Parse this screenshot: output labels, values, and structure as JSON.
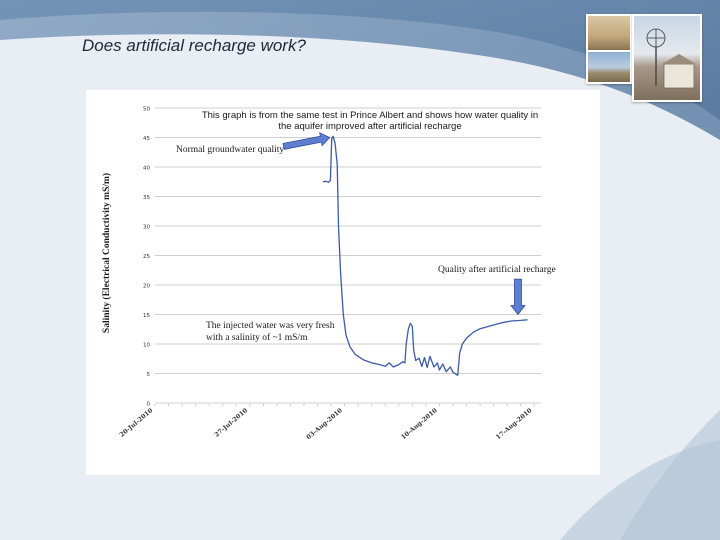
{
  "slide": {
    "title": "Does artificial recharge work?"
  },
  "annotations": {
    "top_line1": "This graph is from the same test in Prince Albert and shows how water quality in",
    "top_line2": "the aquifer improved after artificial recharge",
    "normal": "Normal groundwater quality",
    "after": "Quality after artificial recharge",
    "injected_line1": "The injected water was very fresh",
    "injected_line2": "with a salinity of ~1 mS/m"
  },
  "colors": {
    "series": "#3b5ba5",
    "grid": "#bfbfbf",
    "arrow_fill": "#5e7fd0",
    "arrow_stroke": "#2f4f9e"
  },
  "chart_data": {
    "type": "line",
    "title": "",
    "xlabel": "",
    "ylabel": "Salinity (Electrical Conductivity mS/m)",
    "ylim": [
      0,
      50
    ],
    "yticks": [
      "0",
      "5",
      "10",
      "15",
      "20",
      "25",
      "30",
      "35",
      "40",
      "45",
      "50"
    ],
    "xlim": [
      0,
      28.5
    ],
    "xticks": [
      {
        "x": 0,
        "label": "20-Jul-2010"
      },
      {
        "x": 7,
        "label": "27-Jul-2010"
      },
      {
        "x": 14,
        "label": "03-Aug-2010"
      },
      {
        "x": 21,
        "label": "10-Aug-2010"
      },
      {
        "x": 28,
        "label": "17-Aug-2010"
      }
    ],
    "grid": true,
    "series": [
      {
        "name": "",
        "points": [
          [
            12.4,
            37.5
          ],
          [
            12.6,
            37.6
          ],
          [
            12.8,
            37.4
          ],
          [
            12.95,
            37.7
          ],
          [
            13.05,
            44.8
          ],
          [
            13.15,
            45.2
          ],
          [
            13.3,
            44.0
          ],
          [
            13.45,
            40.5
          ],
          [
            13.55,
            30.0
          ],
          [
            13.7,
            22.0
          ],
          [
            13.9,
            15.0
          ],
          [
            14.1,
            11.5
          ],
          [
            14.4,
            9.5
          ],
          [
            14.8,
            8.2
          ],
          [
            15.4,
            7.3
          ],
          [
            16.0,
            6.8
          ],
          [
            16.6,
            6.5
          ],
          [
            17.0,
            6.2
          ],
          [
            17.3,
            6.8
          ],
          [
            17.6,
            6.1
          ],
          [
            18.0,
            6.5
          ],
          [
            18.3,
            7.0
          ],
          [
            18.45,
            6.8
          ],
          [
            18.55,
            10.0
          ],
          [
            18.7,
            12.5
          ],
          [
            18.85,
            13.5
          ],
          [
            19.0,
            13.0
          ],
          [
            19.1,
            9.0
          ],
          [
            19.25,
            7.2
          ],
          [
            19.5,
            7.6
          ],
          [
            19.7,
            6.2
          ],
          [
            19.9,
            7.7
          ],
          [
            20.1,
            6.0
          ],
          [
            20.3,
            7.9
          ],
          [
            20.6,
            6.1
          ],
          [
            20.85,
            6.8
          ],
          [
            21.0,
            5.6
          ],
          [
            21.25,
            6.6
          ],
          [
            21.5,
            5.3
          ],
          [
            21.8,
            6.1
          ],
          [
            22.0,
            5.2
          ],
          [
            22.2,
            4.9
          ],
          [
            22.35,
            4.7
          ],
          [
            22.5,
            8.5
          ],
          [
            22.7,
            10.0
          ],
          [
            23.0,
            11.0
          ],
          [
            23.5,
            12.0
          ],
          [
            24.0,
            12.6
          ],
          [
            24.8,
            13.1
          ],
          [
            25.6,
            13.6
          ],
          [
            26.3,
            13.9
          ],
          [
            27.0,
            14.0
          ],
          [
            27.5,
            14.1
          ]
        ]
      }
    ],
    "arrows": [
      {
        "name": "normal-quality-arrow",
        "from": [
          9.5,
          43.5
        ],
        "to": [
          12.9,
          45.0
        ]
      },
      {
        "name": "after-recharge-arrow",
        "from": [
          26.8,
          21.0
        ],
        "to": [
          26.8,
          15.0
        ]
      }
    ]
  }
}
